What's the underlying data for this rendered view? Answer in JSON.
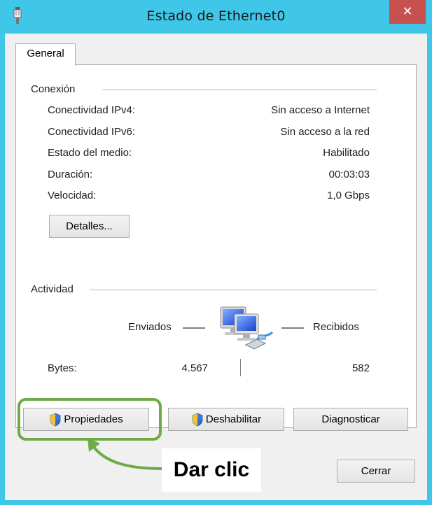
{
  "window": {
    "title": "Estado de Ethernet0",
    "close_glyph": "✕"
  },
  "tabs": [
    {
      "label": "General",
      "selected": true
    }
  ],
  "connection": {
    "section_title": "Conexión",
    "rows": [
      {
        "label": "Conectividad IPv4:",
        "value": "Sin acceso a Internet"
      },
      {
        "label": "Conectividad IPv6:",
        "value": "Sin acceso a la red"
      },
      {
        "label": "Estado del medio:",
        "value": "Habilitado"
      },
      {
        "label": "Duración:",
        "value": "00:03:03"
      },
      {
        "label": "Velocidad:",
        "value": "1,0 Gbps"
      }
    ],
    "details_button": "Detalles..."
  },
  "activity": {
    "section_title": "Actividad",
    "sent_label": "Enviados",
    "received_label": "Recibidos",
    "bytes_label": "Bytes:",
    "bytes_sent": "4.567",
    "bytes_received": "582"
  },
  "actions": {
    "properties": "Propiedades",
    "disable": "Deshabilitar",
    "diagnose": "Diagnosticar",
    "close": "Cerrar"
  },
  "annotation": {
    "callout_text": "Dar clic",
    "highlight_color": "#6faa48"
  },
  "icons": {
    "app": "ethernet-plug-icon",
    "network": "network-computers-icon",
    "shield": "uac-shield-icon"
  },
  "colors": {
    "titlebar": "#3fc6e9",
    "close_button": "#c75050",
    "dialog_bg": "#f0f0f0"
  }
}
